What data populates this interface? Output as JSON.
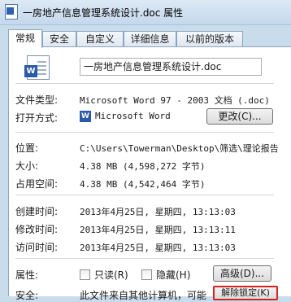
{
  "window": {
    "title": "一房地产信息管理系统设计.doc 属性"
  },
  "tabs": [
    {
      "label": "常规"
    },
    {
      "label": "安全"
    },
    {
      "label": "自定义"
    },
    {
      "label": "详细信息"
    },
    {
      "label": "以前的版本"
    }
  ],
  "general": {
    "filename": "一房地产信息管理系统设计.doc",
    "file_type": {
      "label": "文件类型:",
      "value": "Microsoft Word 97 - 2003 文档 (.doc)"
    },
    "opens_with": {
      "label": "打开方式:",
      "app": "Microsoft Word",
      "change_label": "更改(C)..."
    },
    "location": {
      "label": "位置:",
      "value": "C:\\Users\\Towerman\\Desktop\\筛选\\理论报告"
    },
    "size": {
      "label": "大小:",
      "value": "4.38 MB (4,598,272 字节)"
    },
    "size_on_disk": {
      "label": "占用空间:",
      "value": "4.38 MB (4,542,464 字节)"
    },
    "created": {
      "label": "创建时间:",
      "value": "2013年4月25日, 星期四, 13:13:03"
    },
    "modified": {
      "label": "修改时间:",
      "value": "2013年4月25日, 星期四, 13:13:11"
    },
    "accessed": {
      "label": "访问时间:",
      "value": "2013年4月25日, 星期四, 13:13:03"
    },
    "attributes": {
      "label": "属性:",
      "readonly": "只读(R)",
      "hidden": "隐藏(H)",
      "advanced": "高级(D)..."
    },
    "security": {
      "label": "安全:",
      "text": "此文件来自其他计算机，可能",
      "unblock": "解除锁定(K)"
    }
  }
}
